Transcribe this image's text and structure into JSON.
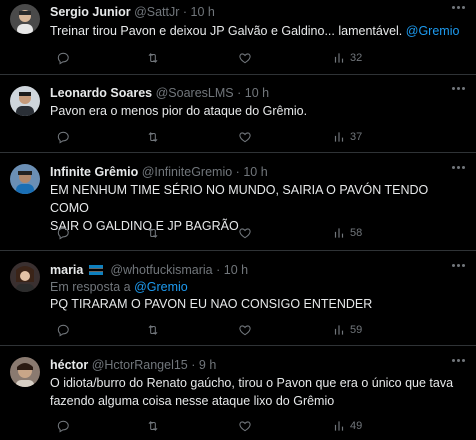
{
  "tweets": [
    {
      "name": "Sergio Junior",
      "handle": "@SattJr",
      "sep": "·",
      "time": "10 h",
      "text": "Treinar tirou Pavon e deixou JP Galvão e Galdino... lamentável.",
      "mention": "@Gremio",
      "views": "32",
      "avatar_icon": "profile-photo"
    },
    {
      "name": "Leonardo Soares",
      "handle": "@SoaresLMS",
      "sep": "·",
      "time": "10 h",
      "text": "Pavon era o menos pior do ataque do Grêmio.",
      "views": "37",
      "avatar_icon": "profile-photo"
    },
    {
      "name": "Infinite Grêmio",
      "handle": "@InfiniteGremio",
      "sep": "·",
      "time": "10 h",
      "text_line1": "EM NENHUM TIME SÉRIO NO MUNDO, SAIRIA O PAVÓN TENDO COMO",
      "text_line2": "SAIR O  GALDINO E JP BAGRÃO",
      "views": "58",
      "avatar_icon": "profile-photo"
    },
    {
      "name": "maria",
      "handle": "@whotfuckismaria",
      "sep": "·",
      "time": "10 h",
      "reply_prefix": "Em resposta a",
      "reply_to": "@Gremio",
      "text": "PQ TIRARAM O PAVON EU NAO CONSIGO ENTENDER",
      "views": "59",
      "avatar_icon": "profile-photo",
      "flag_icon": "gremio-flag-icon"
    },
    {
      "name": "héctor",
      "handle": "@HctorRangel15",
      "sep": "·",
      "time": "9 h",
      "text_line1": "O idiota/burro do Renato gaúcho, tirou o Pavon que era o único que tava",
      "text_line2": "fazendo alguma coisa nesse ataque lixo do Grêmio",
      "views": "49",
      "avatar_icon": "profile-photo"
    }
  ],
  "colors": {
    "background": "#000000",
    "text": "#e7e9ea",
    "muted": "#71767b",
    "accent": "#1d9bf0",
    "divider": "#2f3336"
  },
  "icons": {
    "reply": "reply-icon",
    "retweet": "retweet-icon",
    "like": "heart-icon",
    "views": "views-icon",
    "more": "more-icon"
  }
}
